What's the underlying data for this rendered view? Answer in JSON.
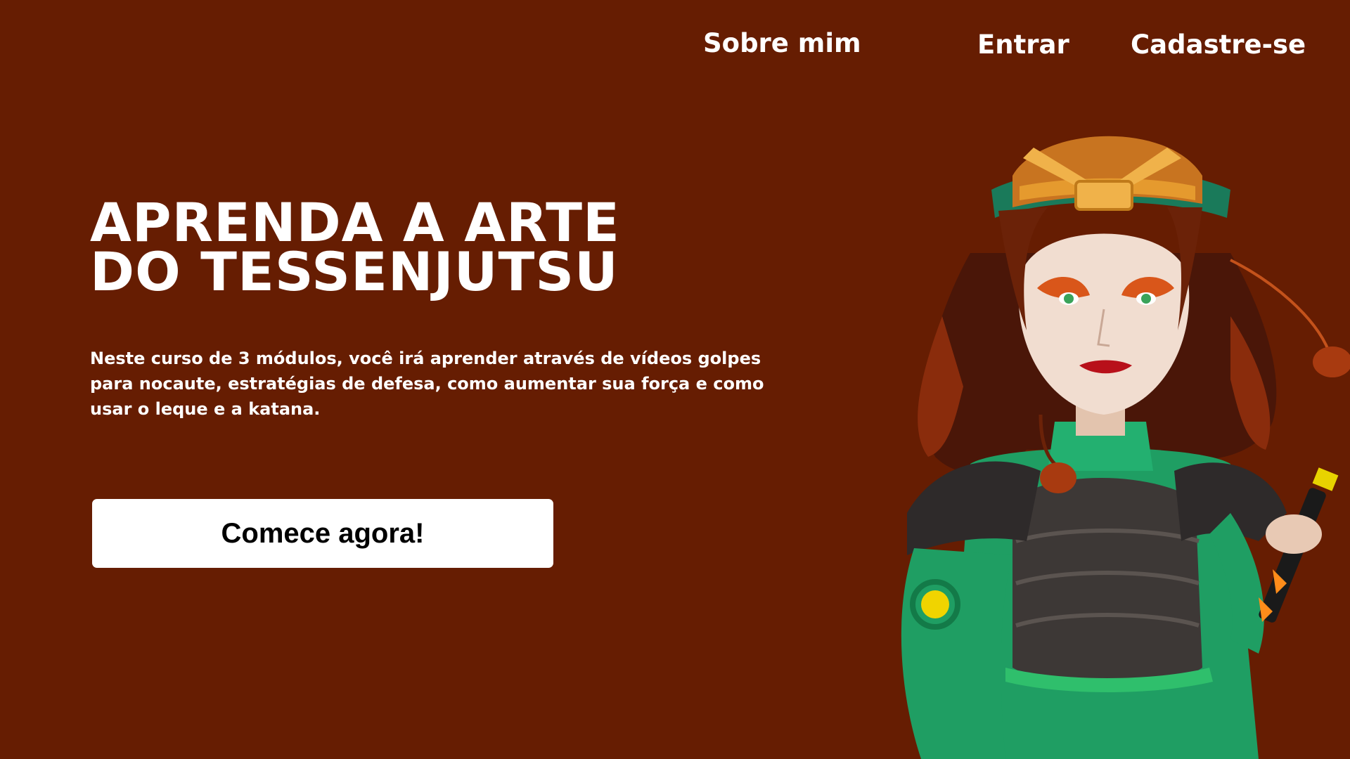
{
  "nav": {
    "about_label": "Sobre mim",
    "login_label": "Entrar",
    "signup_label": "Cadastre-se"
  },
  "hero": {
    "title_line1": "APRENDA A ARTE",
    "title_line2": "DO TESSENJUTSU",
    "description": "Neste curso de 3 módulos, você irá aprender através de vídeos golpes para nocaute, estratégias de defesa, como aumentar sua força e como usar o leque e a katana.",
    "cta_label": "Comece agora!"
  },
  "colors": {
    "background": "#661d02",
    "text": "#ffffff",
    "button_bg": "#ffffff",
    "button_text": "#000000"
  },
  "illustration": {
    "icon": "warrior-character-illustration"
  }
}
